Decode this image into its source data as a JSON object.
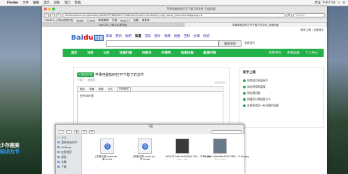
{
  "menubar": {
    "apple": "",
    "app": "Finder",
    "menus": [
      "文件",
      "编辑",
      "显示",
      "前往",
      "窗口",
      "帮助"
    ],
    "clock": "周五 下午7:56",
    "spotlight": "⌕",
    "list": "≡"
  },
  "desktop": {
    "line1": "少存题美",
    "line2": "知识为节"
  },
  "browser": {
    "window_title": "苹果电脑如何打开下载了的文件_百度知道",
    "url": "zhidao.baidu.com/question/1806797788054577188.html?push=core&entry=qb_home_recommend&group=1",
    "search_placeholder": "Google",
    "bookmarks": [
      "Hao123_上网从这里开始",
      "Apple",
      "iCloud",
      "新浪微博",
      "天猫",
      "hao123",
      "优酷",
      "淘宝网"
    ],
    "tabs": [
      "hao123_上网从这里开始",
      "苹果电脑如何打开下载了的文件_百度知道"
    ]
  },
  "baidu": {
    "toplinks": "登录 注册 | 百度首页",
    "logo_prefix": "Bai",
    "logo_du": "du",
    "logo_zhidao": "知道",
    "nav": [
      "新闻",
      "网页",
      "贴吧",
      "知道",
      "音乐",
      "图片",
      "视频",
      "地图",
      "百科",
      "文库",
      "经验"
    ],
    "nav_current_index": 3,
    "search_button": "搜索答案",
    "help": "我要提问",
    "green_nav": [
      "首页",
      "分类",
      "公社",
      "知道行家",
      "问医生",
      "问律师",
      "知道日报",
      "高质问答"
    ],
    "green_right": [
      "开放平台",
      "手机知道",
      "个人中心"
    ]
  },
  "question": {
    "badge": "+知识点5分",
    "title": "苹果电脑如何打开下载了的文件",
    "meta": [
      "下载了",
      "我来答"
    ],
    "count": "1/10000",
    "toolbar": [
      "图片",
      "表格",
      "视频",
      "公式",
      "代码语言"
    ],
    "editor_text": "在finder里"
  },
  "sidebar": {
    "title": "新手上路",
    "items": [
      "如何成为知道高手",
      "如何获得财富值",
      "如何提问题",
      "知道积分等级是什么",
      "去哪里找回一些问题的答案"
    ]
  },
  "finder": {
    "title": "下载",
    "sidebar_header": "个人收藏",
    "sidebar_items": [
      "我的所有文件",
      "AirDrop",
      "应用程序",
      "桌面",
      "文稿",
      "下载"
    ],
    "files": [
      {
        "name": "[完美天堂-www.dy...单.rmvb",
        "dim": ""
      },
      {
        "name": "[完美天堂-www.dy...节.rmvb",
        "dim": ""
      },
      {
        "name": "5f5b751c6c9e63f8a2700...7276.jpg",
        "dim": "900 x 400"
      },
      {
        "name": "515891c4b9b8a32f13389...3.0le.jpg",
        "dim": "320 x 320"
      }
    ]
  },
  "colors": {
    "green": "#25b14a",
    "baidu_blue": "#2d6ec2",
    "baidu_red": "#e10601"
  }
}
